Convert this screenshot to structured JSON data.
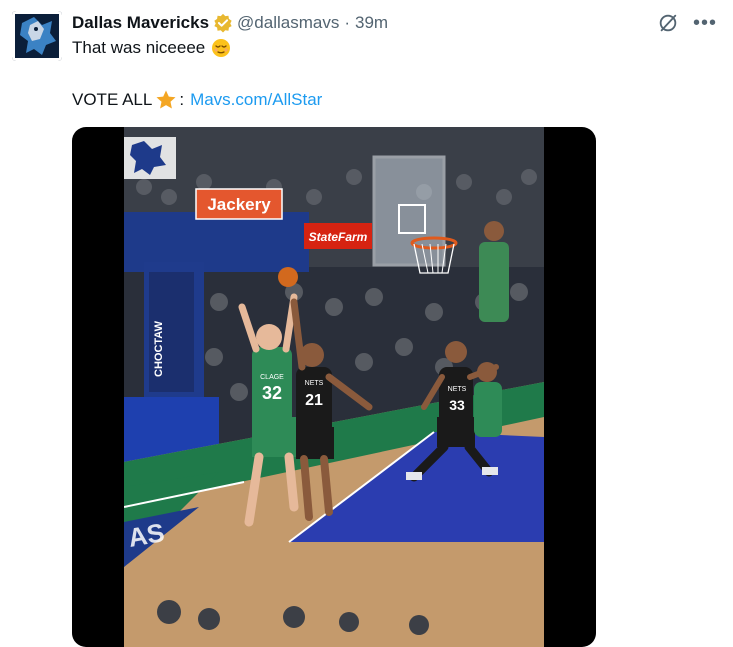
{
  "tweet": {
    "author_name": "Dallas Mavericks",
    "handle": "@dallasmavs",
    "separator": "·",
    "time": "39m",
    "line1_text": "That was niceeee",
    "line2_prefix": "VOTE ALL",
    "line2_colon": ":",
    "link_text": "Mavs.com/AllStar"
  },
  "video": {
    "ad_left": "Jackery",
    "ad_right": "StateFarm",
    "stanchion_sponsor": "CHOCTAW",
    "player_green_number": "32",
    "player_green_name": "CLAGE",
    "player_black_number": "21",
    "player_black2_number": "33",
    "jersey_text": "NETS"
  },
  "icons": {
    "verified": "verified-badge-icon",
    "grok": "grok-icon",
    "more": "more-icon",
    "star": "star-emoji",
    "face": "relieved-face-emoji"
  },
  "colors": {
    "link": "#1d9bf0",
    "verified": "#e8b830",
    "secondary_text": "#536471",
    "court_blue": "#2b3db0",
    "court_green": "#1f7a4a"
  }
}
